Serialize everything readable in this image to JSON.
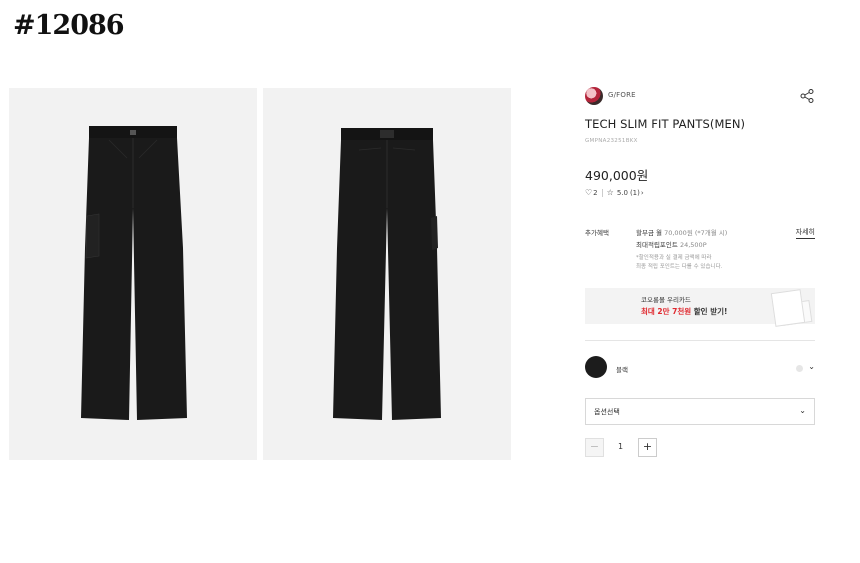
{
  "item_id": "#12086",
  "brand": {
    "name": "G/FORE"
  },
  "product": {
    "title": "TECH SLIM FIT PANTS(MEN)",
    "code": "GMPNA23251BKX",
    "price": "490,000원",
    "likes": "2",
    "rating": "5.0",
    "review_count": "(1)",
    "rating_arrow": "›"
  },
  "benefits": {
    "label": "추가혜택",
    "installment_prefix": "할부금 월",
    "installment_value": "70,000원 (*7개월 시)",
    "points_prefix": "최대적립포인트",
    "points_value": "24,500P",
    "note_line1": "*할인적용과 실 결제 금액에 따라",
    "note_line2": "최종 적립 포인트는 다를 수 있습니다.",
    "detail_link": "자세히"
  },
  "banner": {
    "line1": "코오롱몰 우리카드",
    "line2_red": "최대 2만 7천원",
    "line2_rest": " 할인 받기!"
  },
  "color": {
    "name": "블랙",
    "swatch": "#1c1c1c",
    "chevron": "⌄"
  },
  "option": {
    "placeholder": "옵션선택",
    "chevron": "⌄"
  },
  "quantity": {
    "value": "1",
    "minus": "−",
    "plus": "+"
  },
  "icons": {
    "share": "share-icon",
    "heart": "heart-icon",
    "star": "star-icon"
  },
  "colors": {
    "accent_red": "#e0282e",
    "image_bg": "#f2f2f2",
    "pants": "#1a1a1a"
  }
}
